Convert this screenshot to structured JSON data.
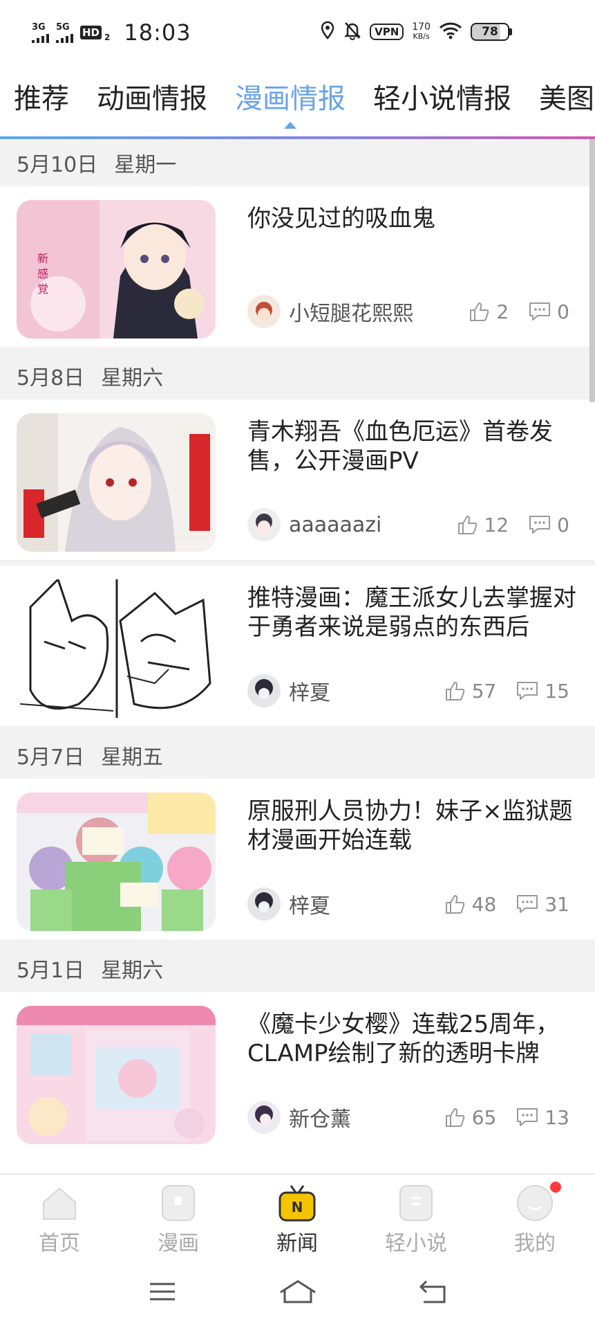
{
  "status_bar": {
    "net1": "3G",
    "net2": "5G",
    "hd": "HD",
    "hd_sub": "2",
    "time": "18:03",
    "vpn": "VPN",
    "speed_value": "170",
    "speed_unit": "KB/s",
    "battery": "78"
  },
  "tabs": [
    {
      "label": "推荐"
    },
    {
      "label": "动画情报"
    },
    {
      "label": "漫画情报"
    },
    {
      "label": "轻小说情报"
    },
    {
      "label": "美图"
    }
  ],
  "active_tab": "漫画情报",
  "groups": [
    {
      "date": "5月10日",
      "weekday": "星期一",
      "articles": [
        {
          "title": "你没见过的吸血鬼",
          "author": "小短腿花熙熙",
          "likes": "2",
          "comments": "0"
        }
      ]
    },
    {
      "date": "5月8日",
      "weekday": "星期六",
      "articles": [
        {
          "title": "青木翔吾《血色厄运》首卷发售，公开漫画PV",
          "author": "aaaaaazi",
          "likes": "12",
          "comments": "0"
        },
        {
          "title": "推特漫画：魔王派女儿去掌握对于勇者来说是弱点的东西后",
          "author": "梓夏",
          "likes": "57",
          "comments": "15"
        }
      ]
    },
    {
      "date": "5月7日",
      "weekday": "星期五",
      "articles": [
        {
          "title": "原服刑人员协力！妹子×监狱题材漫画开始连载",
          "author": "梓夏",
          "likes": "48",
          "comments": "31"
        }
      ]
    },
    {
      "date": "5月1日",
      "weekday": "星期六",
      "articles": [
        {
          "title": "《魔卡少女樱》连载25周年，CLAMP绘制了新的透明卡牌",
          "author": "新仓薰",
          "likes": "65",
          "comments": "13"
        }
      ]
    }
  ],
  "bottom_nav": [
    {
      "label": "首页",
      "icon": "home-icon"
    },
    {
      "label": "漫画",
      "icon": "manga-icon"
    },
    {
      "label": "新闻",
      "icon": "news-tv-icon"
    },
    {
      "label": "轻小说",
      "icon": "novel-icon"
    },
    {
      "label": "我的",
      "icon": "profile-icon"
    }
  ],
  "colors": {
    "accent": "#6aa3e8",
    "badge": "#ff3b3b",
    "news_icon": "#f5c400"
  }
}
